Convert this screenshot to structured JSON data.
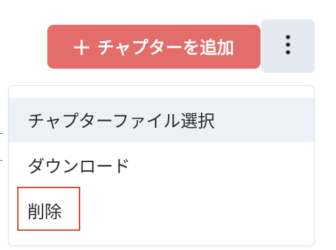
{
  "toolbar": {
    "add_chapter_label": "チャプターを追加"
  },
  "menu": {
    "items": [
      {
        "label": "チャプターファイル選択"
      },
      {
        "label": "ダウンロード"
      },
      {
        "label": "削除"
      }
    ]
  },
  "colors": {
    "accent": "#e26d6a",
    "more_button_bg": "#e3e8f1",
    "menu_hover": "#edf0f6",
    "highlight": "#e0482a"
  },
  "icons": {
    "add": "plus-icon",
    "more": "vertical-dots-icon"
  }
}
